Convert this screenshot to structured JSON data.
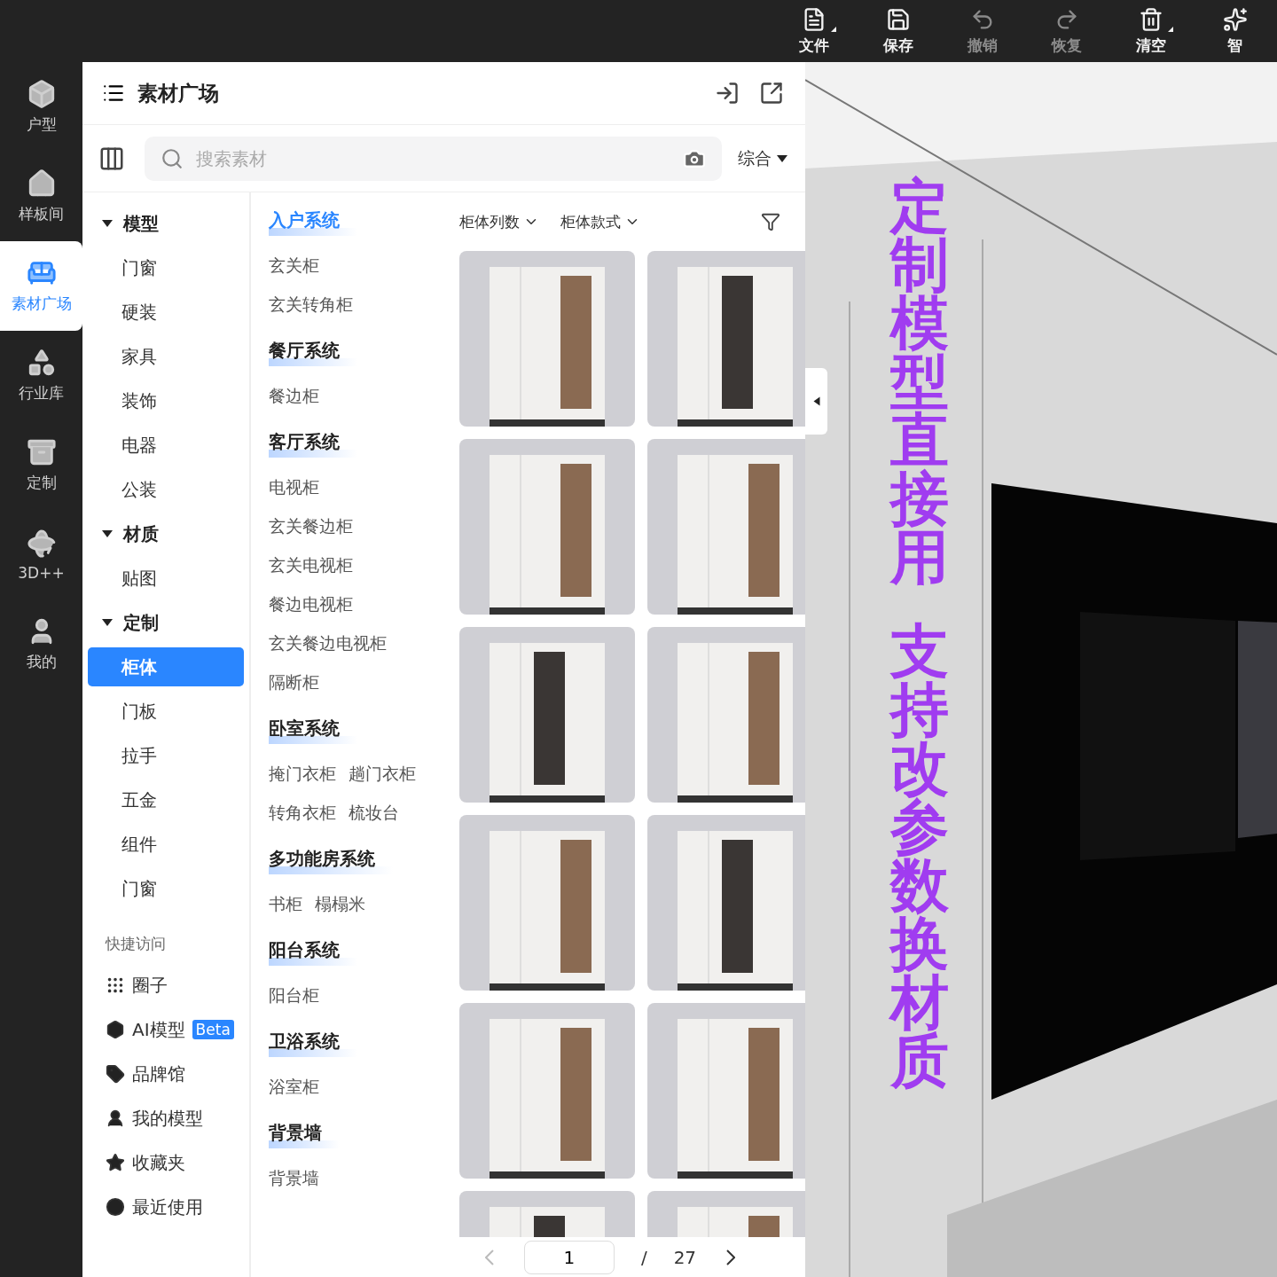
{
  "toolbar": {
    "items": [
      {
        "label": "文件",
        "disabled": false,
        "has_menu": true
      },
      {
        "label": "保存",
        "disabled": false,
        "has_menu": false
      },
      {
        "label": "撤销",
        "disabled": true,
        "has_menu": false
      },
      {
        "label": "恢复",
        "disabled": true,
        "has_menu": false
      },
      {
        "label": "清空",
        "disabled": false,
        "has_menu": true
      },
      {
        "label": "智",
        "disabled": false,
        "has_menu": false
      }
    ]
  },
  "rail": {
    "items": [
      {
        "label": "户型",
        "selected": false
      },
      {
        "label": "样板间",
        "selected": false
      },
      {
        "label": "素材广场",
        "selected": true
      },
      {
        "label": "行业库",
        "selected": false
      },
      {
        "label": "定制",
        "selected": false
      },
      {
        "label": "3D++",
        "selected": false
      },
      {
        "label": "我的",
        "selected": false
      }
    ]
  },
  "panel": {
    "title": "素材广场",
    "search": {
      "placeholder": "搜索素材"
    },
    "sort": "综合"
  },
  "categories": [
    {
      "label": "模型",
      "expanded": true,
      "children": [
        {
          "label": "门窗",
          "selected": false
        },
        {
          "label": "硬装",
          "selected": false
        },
        {
          "label": "家具",
          "selected": false
        },
        {
          "label": "装饰",
          "selected": false
        },
        {
          "label": "电器",
          "selected": false
        },
        {
          "label": "公装",
          "selected": false
        }
      ]
    },
    {
      "label": "材质",
      "expanded": true,
      "children": [
        {
          "label": "贴图",
          "selected": false
        }
      ]
    },
    {
      "label": "定制",
      "expanded": true,
      "children": [
        {
          "label": "柜体",
          "selected": true
        },
        {
          "label": "门板",
          "selected": false
        },
        {
          "label": "拉手",
          "selected": false
        },
        {
          "label": "五金",
          "selected": false
        },
        {
          "label": "组件",
          "selected": false
        },
        {
          "label": "门窗",
          "selected": false
        }
      ]
    }
  ],
  "quick_access": {
    "title": "快捷访问",
    "items": [
      {
        "label": "圈子"
      },
      {
        "label": "AI模型",
        "badge": "Beta"
      },
      {
        "label": "品牌馆"
      },
      {
        "label": "我的模型"
      },
      {
        "label": "收藏夹"
      },
      {
        "label": "最近使用"
      }
    ]
  },
  "systems": [
    {
      "title": "入户系统",
      "selected": true,
      "kind": "list",
      "items": [
        "玄关柜",
        "玄关转角柜"
      ]
    },
    {
      "title": "餐厅系统",
      "selected": false,
      "kind": "list",
      "items": [
        "餐边柜"
      ]
    },
    {
      "title": "客厅系统",
      "selected": false,
      "kind": "list",
      "items": [
        "电视柜",
        "玄关餐边柜",
        "玄关电视柜",
        "餐边电视柜",
        "玄关餐边电视柜",
        "隔断柜"
      ]
    },
    {
      "title": "卧室系统",
      "selected": false,
      "kind": "grid",
      "items": [
        "掩门衣柜",
        "趟门衣柜",
        "转角衣柜",
        "梳妆台"
      ]
    },
    {
      "title": "多功能房系统",
      "selected": false,
      "kind": "grid",
      "items": [
        "书柜",
        "榻榻米"
      ]
    },
    {
      "title": "阳台系统",
      "selected": false,
      "kind": "list",
      "items": [
        "阳台柜"
      ]
    },
    {
      "title": "卫浴系统",
      "selected": false,
      "kind": "list",
      "items": [
        "浴室柜"
      ]
    },
    {
      "title": "背景墙",
      "selected": false,
      "kind": "list",
      "items": [
        "背景墙"
      ]
    }
  ],
  "filters": [
    "柜体列数",
    "柜体款式"
  ],
  "pagination": {
    "page": "1",
    "separator": "/",
    "total": "27"
  },
  "overlay_caption": [
    "定制模型直接用",
    "支持改参数换材质"
  ]
}
